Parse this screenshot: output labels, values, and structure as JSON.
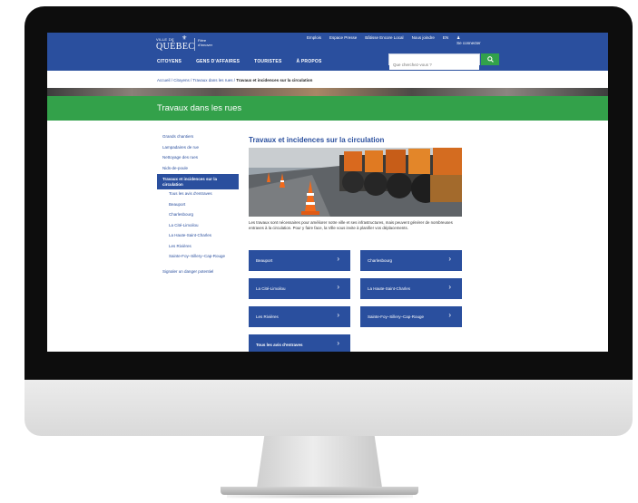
{
  "header": {
    "logo": {
      "ville": "VILLE DE",
      "name": "QUÉBEC",
      "tagline_1": "Fière",
      "tagline_2": "d'innover"
    },
    "utility_links": [
      "Emplois",
      "Espace Presse",
      "Bâtisse Encore Local",
      "Nous joindre",
      "EN",
      "Se connecter"
    ],
    "nav": [
      "CITOYENS",
      "GENS D'AFFAIRES",
      "TOURISTES",
      "À PROPOS"
    ],
    "search": {
      "placeholder": "Que cherchez-vous ?"
    }
  },
  "breadcrumb": {
    "path": "Accueil / Citoyens / Travaux dans les rues / ",
    "current": "Travaux et incidences sur la circulation"
  },
  "section_title": "Travaux dans les rues",
  "sidebar": {
    "items": [
      {
        "label": "Grands chantiers",
        "sub": false,
        "active": false
      },
      {
        "label": "Lampadaires de rue",
        "sub": false,
        "active": false
      },
      {
        "label": "Nettoyage des rues",
        "sub": false,
        "active": false
      },
      {
        "label": "Nids-de-poule",
        "sub": false,
        "active": false
      },
      {
        "label": "Travaux et incidences sur la circulation",
        "sub": false,
        "active": true
      },
      {
        "label": "Tous les avis d'entraves",
        "sub": true,
        "active": false
      },
      {
        "label": "Beauport",
        "sub": true,
        "active": false
      },
      {
        "label": "Charlesbourg",
        "sub": true,
        "active": false
      },
      {
        "label": "La Cité-Limoilou",
        "sub": true,
        "active": false
      },
      {
        "label": "La Haute-Saint-Charles",
        "sub": true,
        "active": false
      },
      {
        "label": "Les Rivières",
        "sub": true,
        "active": false
      },
      {
        "label": "Sainte-Foy–Sillery–Cap-Rouge",
        "sub": true,
        "active": false
      },
      {
        "label": "Signaler un danger potentiel",
        "sub": false,
        "active": false
      }
    ]
  },
  "content": {
    "title": "Travaux et incidences sur la circulation",
    "intro": "Les travaux sont nécessaires pour améliorer notre ville et ses infrastructures, mais peuvent générer de nombreuses entraves à la circulation. Pour y faire face, la Ville vous invite à planifier vos déplacements.",
    "tiles": [
      {
        "label": "Beauport"
      },
      {
        "label": "Charlesbourg"
      },
      {
        "label": "La Cité-Limoilou"
      },
      {
        "label": "La Haute-Saint-Charles"
      },
      {
        "label": "Les Rivières"
      },
      {
        "label": "Sainte-Foy–Sillery–Cap-Rouge"
      },
      {
        "label": "Tous les avis d'entraves"
      }
    ],
    "chevron": "›"
  },
  "colors": {
    "brand_blue": "#2a4f9e",
    "green": "#33a14a",
    "bezel": "#0d0d0d"
  }
}
